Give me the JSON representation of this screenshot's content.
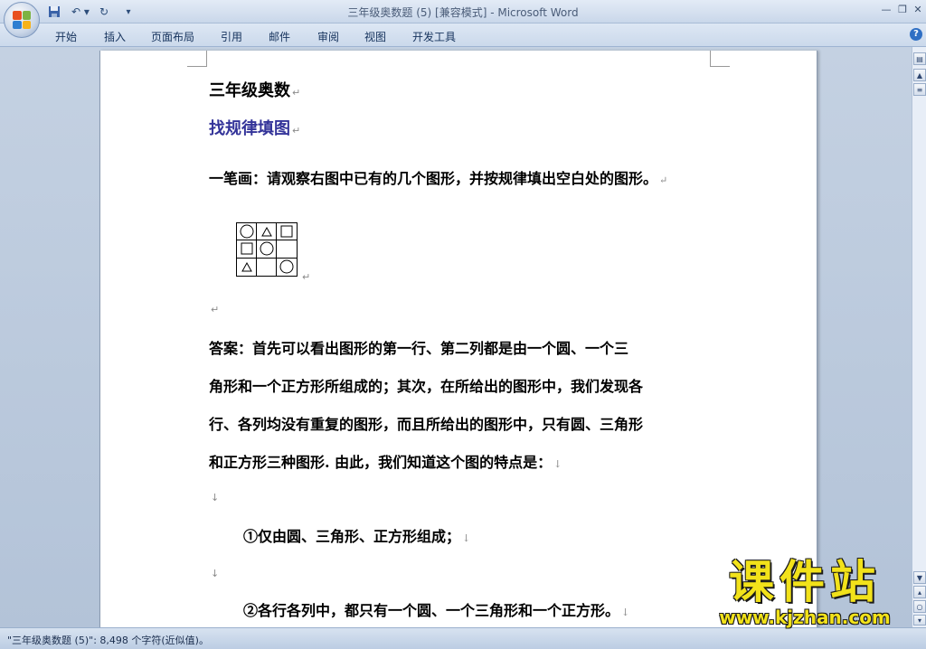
{
  "window": {
    "title": "三年级奥数题 (5) [兼容模式] - Microsoft Word",
    "controls": [
      "—",
      "❐",
      "✕"
    ]
  },
  "quick_access": {
    "save_icon": "save-icon",
    "undo": "↶ ▾",
    "redo": "↻",
    "customize": "▾"
  },
  "ribbon": {
    "tabs": [
      "开始",
      "插入",
      "页面布局",
      "引用",
      "邮件",
      "审阅",
      "视图",
      "开发工具"
    ],
    "help": "?"
  },
  "document": {
    "heading": "三年级奥数",
    "subheading": "找规律填图",
    "question": "一笔画：请观察右图中已有的几个图形，并按规律填出空白处的图形。",
    "puzzle": [
      [
        "circle",
        "triangle",
        "square"
      ],
      [
        "square",
        "circle",
        ""
      ],
      [
        "triangle",
        "",
        "circle"
      ]
    ],
    "answer_lines": [
      "  答案：首先可以看出图形的第一行、第二列都是由一个圆、一个三",
      "角形和一个正方形所组成的；其次，在所给出的图形中，我们发现各",
      "行、各列均没有重复的图形，而且所给出的图形中，只有圆、三角形",
      "和正方形三种图形. 由此，我们知道这个图的特点是："
    ],
    "point1": "①仅由圆、三角形、正方形组成；",
    "point2": "②各行各列中，都只有一个圆、一个三角形和一个正方形。",
    "para_mark": "↵",
    "line_mark": "↓"
  },
  "status": {
    "text": "\"三年级奥数题 (5)\": 8,498 个字符(近似值)。"
  },
  "watermark": {
    "line1": "课件站",
    "line2": "www.kjzhan.com"
  },
  "colors": {
    "subheading": "#333399",
    "watermark": "#f2e21a"
  }
}
